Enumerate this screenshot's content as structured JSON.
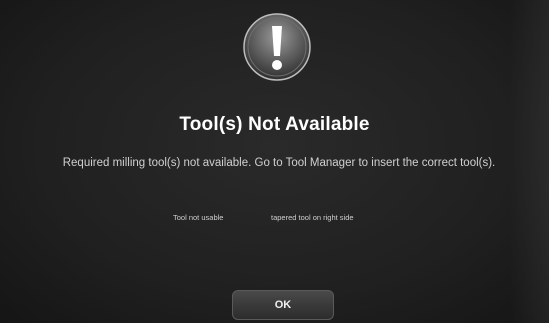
{
  "dialog": {
    "icon": "exclamation-warning-icon",
    "title": "Tool(s) Not Available",
    "message": "Required milling tool(s) not available. Go to Tool Manager to insert the correct tool(s).",
    "tool_status": {
      "label": "Tool not usable",
      "detail": "tapered tool on right side"
    },
    "ok_label": "OK"
  },
  "colors": {
    "background": "#202020",
    "title": "#ffffff",
    "text": "#d0d0d0",
    "button": "#3a3a3a"
  }
}
